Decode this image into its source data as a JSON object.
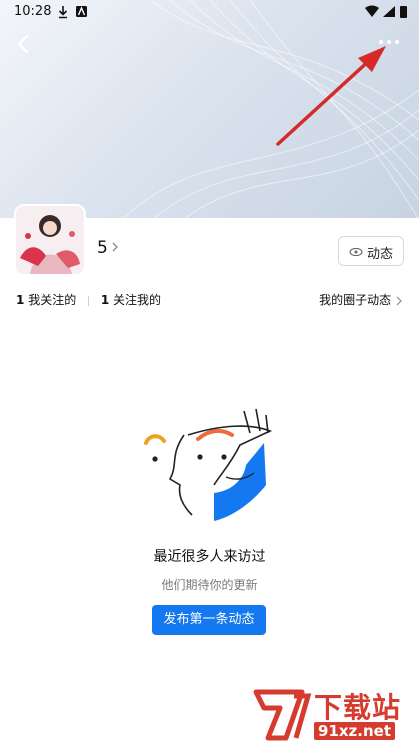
{
  "status_bar": {
    "time": "10:28"
  },
  "profile": {
    "name": "5",
    "follow_label": "动态"
  },
  "stats": {
    "following_count": "1",
    "following_label": "我关注的",
    "followers_count": "1",
    "followers_label": "关注我的",
    "circle_link": "我的圈子动态"
  },
  "empty_state": {
    "title": "最近很多人来访过",
    "subtitle": "他们期待你的更新",
    "button_label": "发布第一条动态"
  },
  "watermark": {
    "brand_cn": "下载站",
    "url": "91xz.net"
  },
  "colors": {
    "accent": "#1478f0",
    "watermark": "#d63b2f",
    "arrow": "#d42a2a"
  }
}
